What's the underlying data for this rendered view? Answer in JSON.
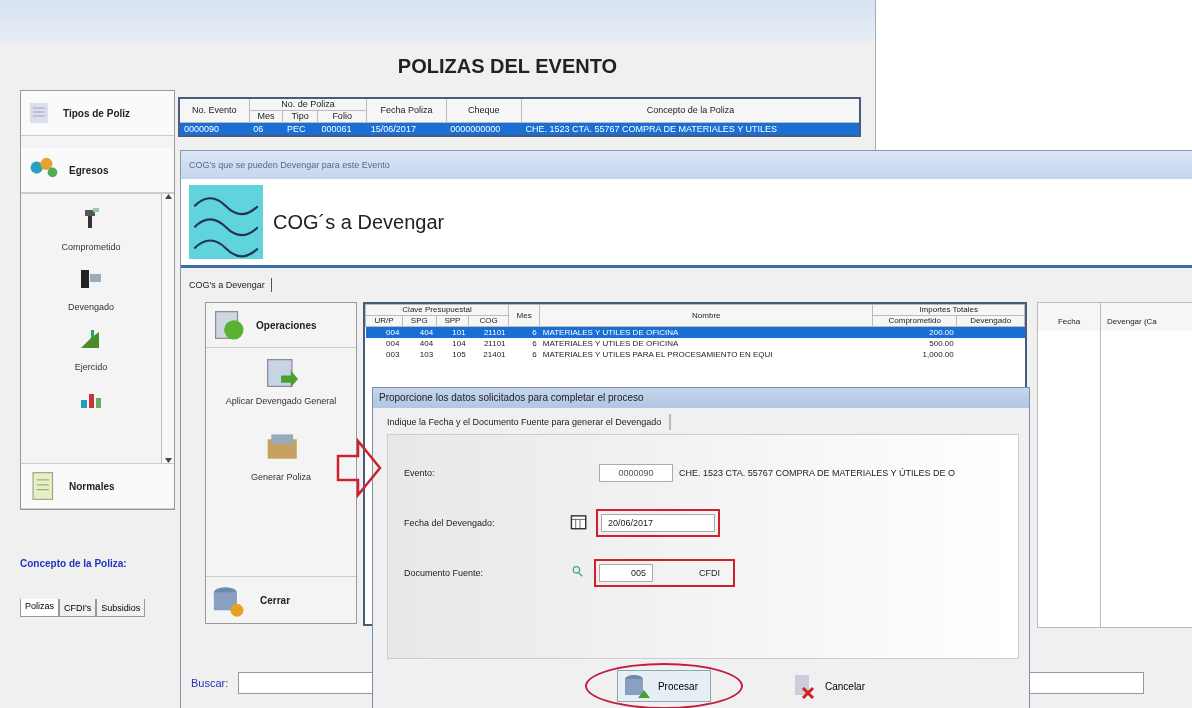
{
  "main_window": {
    "heading": "POLIZAS DEL EVENTO",
    "nav": {
      "header": "Tipos de Poliz",
      "section": "Egresos",
      "items": [
        {
          "label": "Comprometido",
          "kind": "stamp"
        },
        {
          "label": "Devengado",
          "kind": "printer"
        },
        {
          "label": "Ejercido",
          "kind": "chart"
        },
        {
          "kind": "bars"
        }
      ],
      "footer": "Normales"
    },
    "polizas_table": {
      "columns": [
        {
          "label": "No. Evento"
        },
        {
          "label": "No. de Poliza",
          "colspan": 3,
          "subcolumns": [
            "Mes",
            "Tipo",
            "Folio"
          ]
        },
        {
          "label": "Fecha Poliza"
        },
        {
          "label": "Cheque"
        },
        {
          "label": "Concepto de la Poliza"
        }
      ],
      "rows": [
        {
          "cells": [
            "0000090",
            "06",
            "PEC",
            "000061",
            "15/06/2017",
            "0000000000",
            "CHE. 1523 CTA. 55767 COMPRA DE MATERIALES Y UTILES"
          ],
          "selected": true
        }
      ]
    },
    "concepto_label": "Concepto de la Poliza:",
    "tabs": [
      {
        "label": "Polizas",
        "selected": true
      },
      {
        "label": "CFDI's",
        "selected": false
      },
      {
        "label": "Subsidios",
        "selected": false
      }
    ]
  },
  "cog_window": {
    "title": "COG's que se pueden Devengar para este Evento",
    "heading": "COG´s a Devengar",
    "tab": "COG's a Devengar",
    "operations": {
      "header": "Operaciones",
      "items": [
        "Aplicar Devengado General",
        "Generar Poliza"
      ],
      "footer": "Cerrar"
    },
    "table": {
      "columns": [
        {
          "label": "Clave Presupuestal",
          "colspan": 4,
          "subcolumns": [
            "UR/P",
            "SPG",
            "SPP",
            "COG"
          ]
        },
        {
          "label": "Mes"
        },
        {
          "label": "Nombre"
        },
        {
          "label": "Importes Totales",
          "colspan": 2,
          "subcolumns": [
            "Comprometido",
            "Devengado"
          ]
        }
      ],
      "rows": [
        {
          "cells": [
            "004",
            "404",
            "101",
            "21101",
            "6",
            "MATERIALES Y UTILES DE OFICINA",
            "200.00"
          ],
          "selected": true
        },
        {
          "cells": [
            "004",
            "404",
            "104",
            "21101",
            "6",
            "MATERIALES Y UTILES DE OFICINA",
            "500.00"
          ],
          "selected": false
        },
        {
          "cells": [
            "003",
            "103",
            "105",
            "21401",
            "6",
            "MATERIALES Y UTILES PARA EL PROCESAMIENTO EN EQUI",
            "1,000.00"
          ],
          "selected": false
        }
      ]
    },
    "side_columns": [
      "Fecha",
      "Devengar (Ca"
    ],
    "search": {
      "label": "Buscar:"
    }
  },
  "dialog": {
    "title": "Proporcione los datos solicitados para completar el proceso",
    "tab": "Indique la Fecha y el Documento Fuente para generar el Devengado",
    "fields": [
      {
        "kind": "evento",
        "label": "Evento:",
        "value": "0000090",
        "description": "CHE. 1523 CTA. 55767 COMPRA DE MATERIALES Y ÚTILES DE O",
        "highlighted": false
      },
      {
        "kind": "date",
        "label": "Fecha del Devengado:",
        "value": "20/06/2017",
        "highlighted": true
      },
      {
        "kind": "document",
        "label": "Documento Fuente:",
        "value": "005",
        "description": "CFDI",
        "highlighted": true
      }
    ],
    "buttons": [
      {
        "kind": "process",
        "label": "Procesar",
        "highlighted": true
      },
      {
        "kind": "cancel",
        "label": "Cancelar",
        "highlighted": false
      }
    ]
  }
}
